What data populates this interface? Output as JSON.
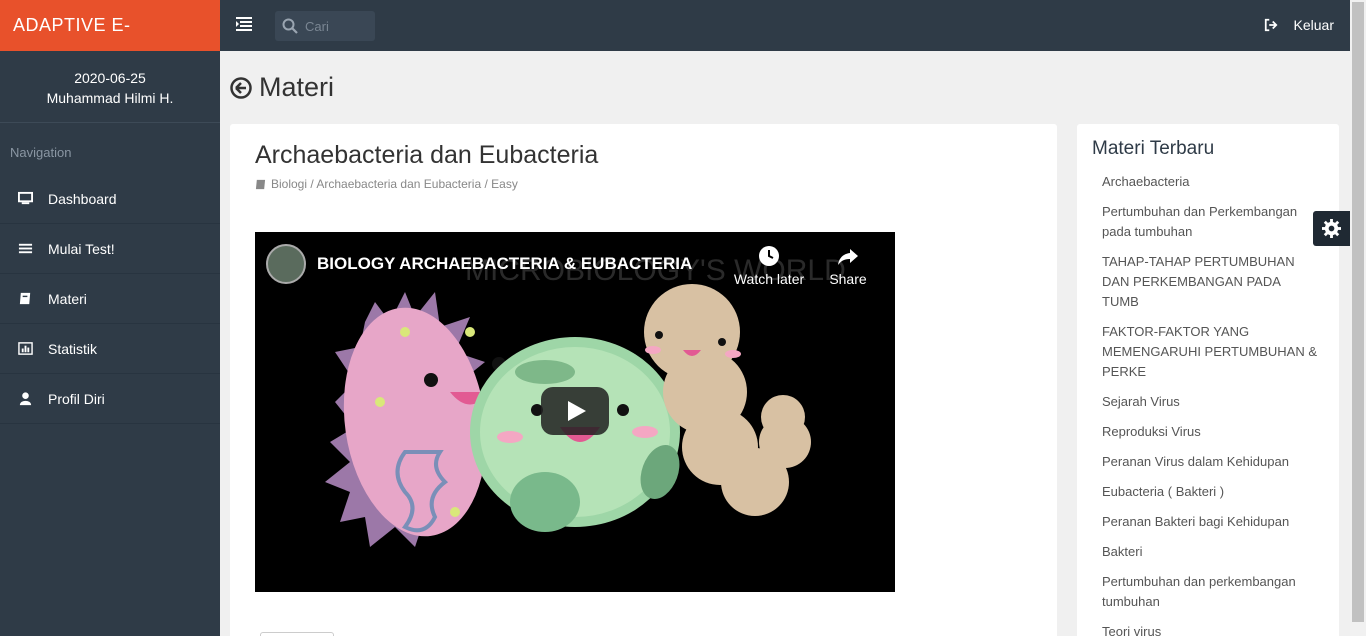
{
  "brand": "ADAPTIVE E-LEARNING",
  "search": {
    "placeholder": "Cari"
  },
  "logout_label": "Keluar",
  "profile": {
    "date": "2020-06-25",
    "name": "Muhammad Hilmi H."
  },
  "nav": {
    "title": "Navigation",
    "items": [
      {
        "label": "Dashboard",
        "icon": "desktop-icon"
      },
      {
        "label": "Mulai Test!",
        "icon": "list-icon"
      },
      {
        "label": "Materi",
        "icon": "book-icon"
      },
      {
        "label": "Statistik",
        "icon": "bar-chart-icon"
      },
      {
        "label": "Profil Diri",
        "icon": "user-icon"
      }
    ]
  },
  "page": {
    "title": "Materi"
  },
  "content": {
    "title": "Archaebacteria dan Eubacteria",
    "breadcrumb": "Biologi / Archaebacteria dan Eubacteria / Easy",
    "video": {
      "title": "BIOLOGY ARCHAEBACTERIA & EUBACTERIA",
      "watch_later": "Watch later",
      "share": "Share"
    }
  },
  "sidebar_right": {
    "title": "Materi Terbaru",
    "items": [
      "Archaebacteria",
      "Pertumbuhan dan Perkembangan pada tumbuhan",
      "TAHAP-TAHAP PERTUMBUHAN DAN PERKEMBANGAN PADA TUMB",
      "FAKTOR-FAKTOR YANG MEMENGARUHI PERTUMBUHAN & PERKE",
      "Sejarah Virus",
      "Reproduksi Virus",
      "Peranan Virus dalam Kehidupan",
      "Eubacteria ( Bakteri )",
      "Peranan Bakteri bagi Kehidupan",
      "Bakteri",
      "Pertumbuhan dan perkembangan tumbuhan",
      "Teori virus"
    ]
  },
  "colors": {
    "brand": "#e8512b",
    "topbar": "#2f3b47",
    "sidebar": "#2f3b47"
  }
}
